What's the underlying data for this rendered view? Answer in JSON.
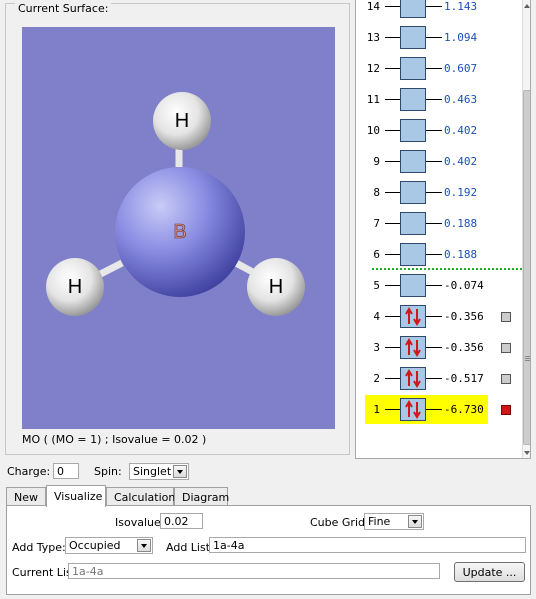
{
  "surface": {
    "title": "Current Surface:",
    "caption": "MO ( (MO = 1) ; Isovalue = 0.02 )",
    "atoms": {
      "center": "B",
      "top": "H",
      "left": "H",
      "right": "H"
    }
  },
  "mo_diagram": {
    "rows": [
      {
        "num": "14",
        "energy": "1.143",
        "occupied": false
      },
      {
        "num": "13",
        "energy": "1.094",
        "occupied": false
      },
      {
        "num": "12",
        "energy": "0.607",
        "occupied": false
      },
      {
        "num": "11",
        "energy": "0.463",
        "occupied": false
      },
      {
        "num": "10",
        "energy": "0.402",
        "occupied": false
      },
      {
        "num": "9",
        "energy": "0.402",
        "occupied": false
      },
      {
        "num": "8",
        "energy": "0.192",
        "occupied": false
      },
      {
        "num": "7",
        "energy": "0.188",
        "occupied": false
      },
      {
        "num": "6",
        "energy": "0.188",
        "occupied": false
      },
      {
        "num": "5",
        "energy": "-0.074",
        "occupied": false
      },
      {
        "num": "4",
        "energy": "-0.356",
        "occupied": true,
        "selected": false
      },
      {
        "num": "3",
        "energy": "-0.356",
        "occupied": true,
        "selected": false
      },
      {
        "num": "2",
        "energy": "-0.517",
        "occupied": true,
        "selected": false
      },
      {
        "num": "1",
        "energy": "-6.730",
        "occupied": true,
        "selected": true
      }
    ],
    "highlight_color": "#ffff00",
    "homo_line_color": "#1fae2f",
    "unoccupied_energy_color": "#1d4fb5"
  },
  "charge": {
    "label": "Charge:",
    "value": "0"
  },
  "spin": {
    "label": "Spin:",
    "value": "Singlet"
  },
  "tabs": [
    {
      "label": "New",
      "active": false
    },
    {
      "label": "Visualize",
      "active": true
    },
    {
      "label": "Calculation",
      "active": false
    },
    {
      "label": "Diagram",
      "active": false
    }
  ],
  "visualize": {
    "isovalue_label": "Isovalue:",
    "isovalue": "0.02",
    "cube_grid_label": "Cube Grid:",
    "cube_grid": "Fine",
    "add_type_label": "Add Type:",
    "add_type": "Occupied",
    "add_list_label": "Add List:",
    "add_list": "1a-4a",
    "current_list_label": "Current List:",
    "current_list_placeholder": "1a-4a",
    "update_button": "Update ..."
  }
}
